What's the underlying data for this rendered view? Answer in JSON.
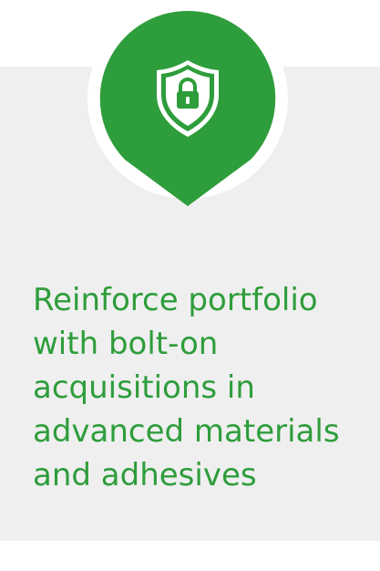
{
  "card": {
    "headline": "Reinforce portfolio\nwith bolt-on\nacquisitions in\nadvanced materials\nand adhesives"
  },
  "icon": {
    "name": "shield-lock-icon",
    "container": "map-pin"
  },
  "colors": {
    "accent": "#2e9d3b",
    "card_background": "#efefef",
    "page_background": "#ffffff",
    "icon_foreground": "#ffffff"
  }
}
